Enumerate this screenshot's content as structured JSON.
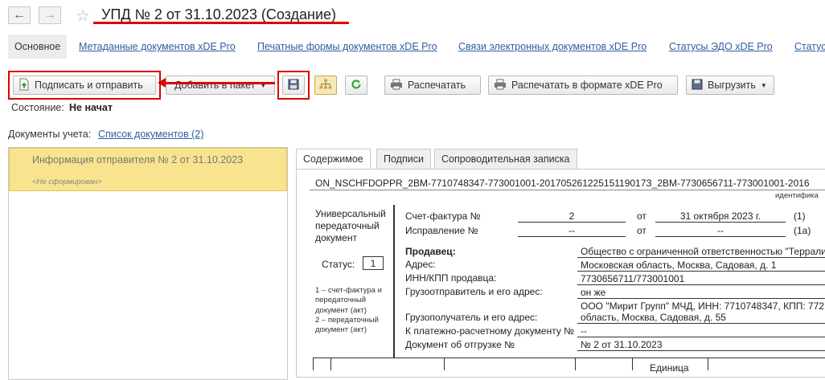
{
  "header": {
    "back_icon": "←",
    "forward_icon": "→",
    "star_icon": "☆",
    "title": "УПД № 2 от 31.10.2023 (Создание)"
  },
  "tabs": [
    {
      "label": "Основное"
    },
    {
      "label": "Метаданные документов xDE Pro"
    },
    {
      "label": "Печатные формы документов xDE Pro"
    },
    {
      "label": "Связи электронных документов xDE Pro"
    },
    {
      "label": "Статусы ЭДО xDE Pro"
    },
    {
      "label": "Статус"
    }
  ],
  "toolbar": {
    "sign_send": "Подписать и отправить",
    "add_package": "Добавить в пакет",
    "print": "Распечатать",
    "print_xde": "Распечатать в формате xDE Pro",
    "export": "Выгрузить"
  },
  "status": {
    "label": "Состояние:",
    "value": "Не начат"
  },
  "docs": {
    "label": "Документы учета:",
    "link": "Список документов (2)"
  },
  "left_list": {
    "item_title": "Информация отправителя № 2 от 31.10.2023",
    "item_status": "<Не сформирован>"
  },
  "doc_tabs": [
    {
      "label": "Содержимое"
    },
    {
      "label": "Подписи"
    },
    {
      "label": "Сопроводительная записка"
    }
  ],
  "document": {
    "filename": "ON_NSCHFDOPPR_2BM-7710748347-773001001-20170526122515119017З_2BM-7730656711-773001001-2016",
    "id_label": "идентифика",
    "type_line1": "Универсальный",
    "type_line2": "передаточный",
    "type_line3": "документ",
    "status_label": "Статус:",
    "status_value": "1",
    "note1_line1": "1 – счет-фактура и",
    "note1_line2": "передаточный",
    "note1_line3": "документ (акт)",
    "note2_line1": "2 – передаточный",
    "note2_line2": "документ (акт)",
    "invoice_label": "Счет-фактура №",
    "invoice_no": "2",
    "from1": "от",
    "invoice_date": "31 октября 2023 г.",
    "ref1": "(1)",
    "fix_label": "Исправление №",
    "fix_no": "--",
    "from2": "от",
    "fix_date": "--",
    "ref1a": "(1а)",
    "seller_label": "Продавец:",
    "seller_value": "Общество с ограниченной ответственностью \"Террали",
    "address_label": "Адрес:",
    "address_value": "Московская область, Москва, Садовая, д.  1",
    "inn_label": "ИНН/КПП продавца:",
    "inn_value": "7730656711/773001001",
    "shipper_label": "Грузоотправитель и его адрес:",
    "shipper_value": "он же",
    "consignee_label": "Грузополучатель и его адрес:",
    "consignee_line1": "ООО \"Мирит Групп\" МЧД, ИНН: 7710748347, КПП: 772",
    "consignee_line2": "область, Москва, Садовая, д. 55",
    "payment_label": "К платежно-расчетному документу №",
    "payment_value": "--",
    "shipment_label": "Документ об отгрузке №",
    "shipment_value": "№ 2 от 31.10.2023",
    "table_header": "Единица"
  },
  "icons": {
    "sign": "document-up-icon",
    "save": "floppy-icon",
    "structure": "hierarchy-icon",
    "refresh": "refresh-icon",
    "print": "printer-icon",
    "export": "export-icon"
  }
}
